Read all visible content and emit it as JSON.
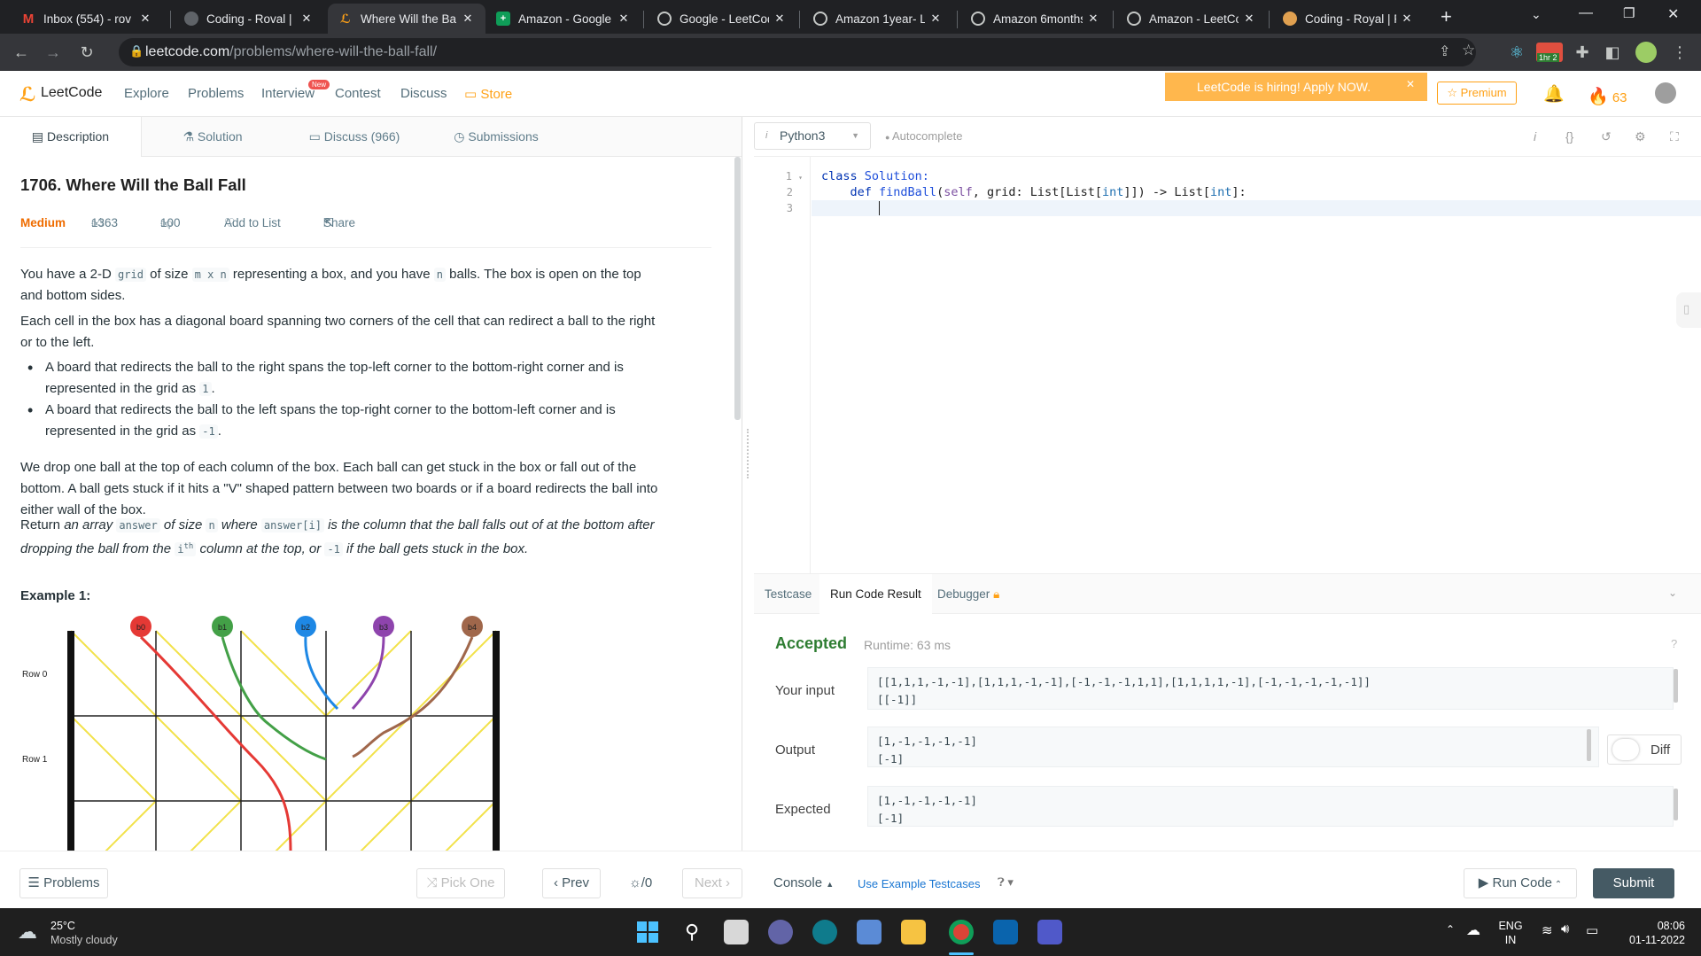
{
  "browser": {
    "tabs": [
      {
        "title": "Inbox (554) - rov",
        "icon": "gmail-icon",
        "color": "#ea4335"
      },
      {
        "title": "Coding - Roval | H",
        "icon": "avatar-icon",
        "color": "#5f6368"
      },
      {
        "title": "Where Will the Ba",
        "icon": "leetcode-icon",
        "color": "#ffa116"
      },
      {
        "title": "Amazon - Google",
        "icon": "sheets-icon",
        "color": "#0f9d58"
      },
      {
        "title": "Google - LeetCod",
        "icon": "github-icon",
        "color": "#9aa0a6"
      },
      {
        "title": "Amazon 1year- L",
        "icon": "github-icon",
        "color": "#9aa0a6"
      },
      {
        "title": "Amazon 6months",
        "icon": "github-icon",
        "color": "#9aa0a6"
      },
      {
        "title": "Amazon - LeetCo",
        "icon": "github-icon",
        "color": "#9aa0a6"
      },
      {
        "title": "Coding - Royal | F",
        "icon": "avatar-icon",
        "color": "#e0a050"
      }
    ],
    "url_host": "leetcode.com",
    "url_path": "/problems/where-will-the-ball-fall/",
    "ext_badge": "1hr 2"
  },
  "nav": {
    "logo": "LeetCode",
    "links": [
      "Explore",
      "Problems",
      "Interview",
      "Contest",
      "Discuss"
    ],
    "new_badge": "New",
    "store": "Store",
    "hiring": "LeetCode is hiring! Apply NOW.",
    "premium": "Premium",
    "streak": "63"
  },
  "desc_tabs": [
    "Description",
    "Solution",
    "Discuss (966)",
    "Submissions"
  ],
  "problem": {
    "title": "1706. Where Will the Ball Fall",
    "difficulty": "Medium",
    "likes": "1363",
    "dislikes": "100",
    "add_to_list": "Add to List",
    "share": "Share",
    "p1a": "You have a 2-D ",
    "p1b": "grid",
    "p1c": " of size ",
    "p1d": "m x n",
    "p1e": " representing a box, and you have ",
    "p1f": "n",
    "p1g": " balls. The box is open on the top",
    "p1h": "and bottom sides.",
    "p2a": "Each cell in the box has a diagonal board spanning two corners of the cell that can redirect a ball to the right",
    "p2b": "or to the left.",
    "b1a": "A board that redirects the ball to the right spans the top-left corner to the bottom-right corner and is",
    "b1b": "represented in the grid as ",
    "b1c": "1",
    "b2a": "A board that redirects the ball to the left spans the top-right corner to the bottom-left corner and is",
    "b2b": "represented in the grid as ",
    "b2c": "-1",
    "p3a": "We drop one ball at the top of each column of the box. Each ball can get stuck in the box or fall out of the",
    "p3b": "bottom. A ball gets stuck if it hits a \"V\" shaped pattern between two boards or if a board redirects the ball into",
    "p3c": "either wall of the box.",
    "p4a": "Return ",
    "p4b": "an array ",
    "p4c": "answer",
    "p4d": " of size ",
    "p4e": "n",
    "p4f": " where ",
    "p4g": "answer[i]",
    "p4h": " is the column that the ball falls out of at the bottom after",
    "p4i": "dropping the ball from the ",
    "p4j": "i",
    "p4k": "th",
    "p4l": " column at the top, or ",
    "p4m": "-1",
    "p4n": " if the ball gets stuck in the box.",
    "example_title": "Example 1:",
    "balls": [
      "b0",
      "b1",
      "b2",
      "b3",
      "b4"
    ],
    "ball_colors": [
      "#e53935",
      "#43a047",
      "#1e88e5",
      "#8e44ad",
      "#a0674b"
    ],
    "rows": [
      "Row 0",
      "Row 1"
    ]
  },
  "editor": {
    "language": "Python3",
    "autocomplete": "Autocomplete",
    "line_numbers": [
      "1",
      "2",
      "3"
    ],
    "code_l1_kw": "class",
    "code_l1_name": " Solution:",
    "code_l2_indent": "    ",
    "code_l2_def": "def",
    "code_l2_fn": " findBall",
    "code_l2_open": "(",
    "code_l2_self": "self",
    "code_l2_mid": ", grid: List[List[",
    "code_l2_int1": "int",
    "code_l2_mid2": "]]) -> List[",
    "code_l2_int2": "int",
    "code_l2_end": "]:"
  },
  "result_tabs": [
    "Testcase",
    "Run Code Result",
    "Debugger"
  ],
  "result": {
    "status": "Accepted",
    "runtime": "Runtime: 63 ms",
    "input_label": "Your input",
    "input_l1": "[[1,1,1,-1,-1],[1,1,1,-1,-1],[-1,-1,-1,1,1],[1,1,1,1,-1],[-1,-1,-1,-1,-1]]",
    "input_l2": "[[-1]]",
    "output_label": "Output",
    "output_l1": "[1,-1,-1,-1,-1]",
    "output_l2": "[-1]",
    "expected_label": "Expected",
    "expected_l1": "[1,-1,-1,-1,-1]",
    "expected_l2": "[-1]",
    "diff": "Diff"
  },
  "bottom": {
    "problems": "Problems",
    "pick_one": "Pick One",
    "prev": "Prev",
    "counter": "/0",
    "next": "Next",
    "console": "Console",
    "use_example": "Use Example Testcases",
    "run_code": "Run Code",
    "submit": "Submit"
  },
  "taskbar": {
    "temp": "25°C",
    "weather": "Mostly cloudy",
    "lang1": "ENG",
    "lang2": "IN",
    "time": "08:06",
    "date": "01-11-2022"
  }
}
